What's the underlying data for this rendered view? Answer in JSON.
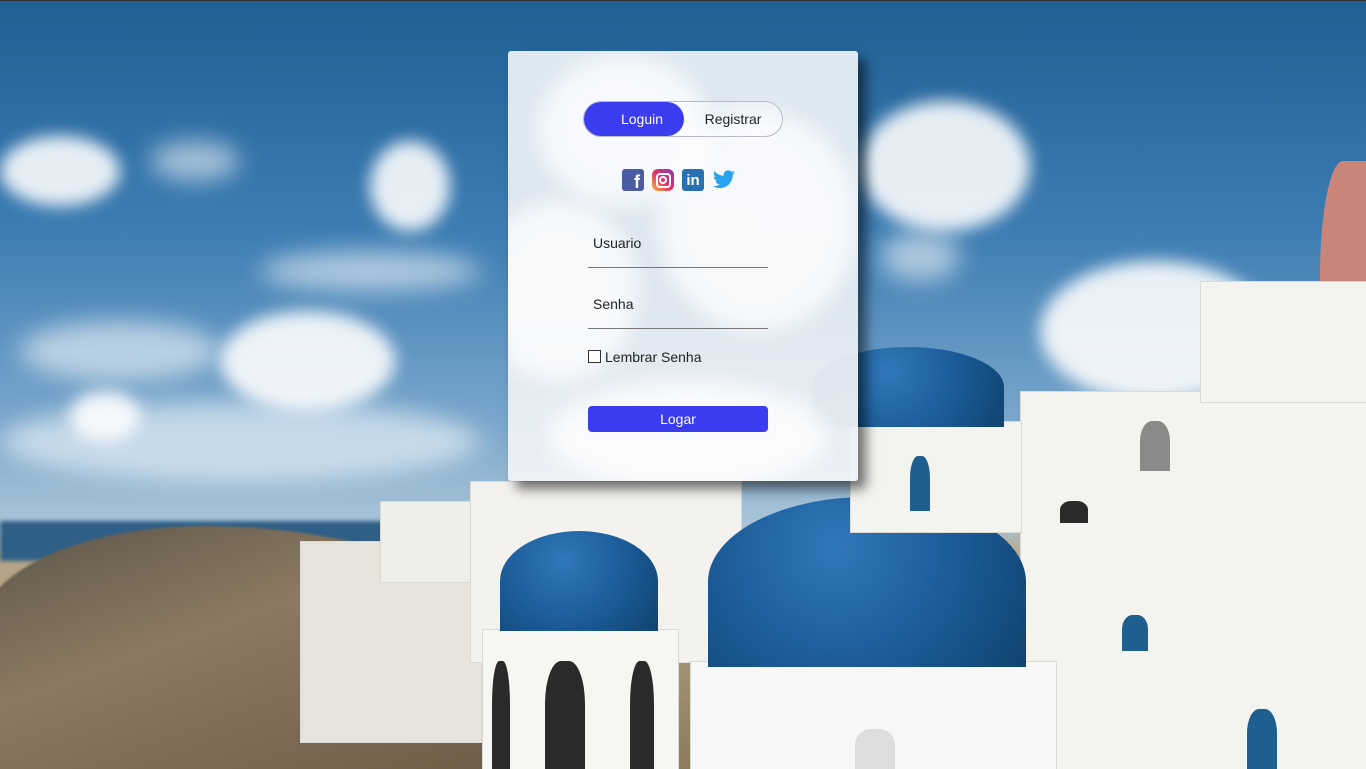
{
  "tabs": {
    "login_label": "Loguin",
    "register_label": "Registrar"
  },
  "social": {
    "facebook": "f",
    "linkedin": "in"
  },
  "form": {
    "username_label": "Usuario",
    "password_label": "Senha",
    "remember_label": "Lembrar Senha",
    "submit_label": "Logar"
  },
  "colors": {
    "accent": "#3b3bf0"
  }
}
